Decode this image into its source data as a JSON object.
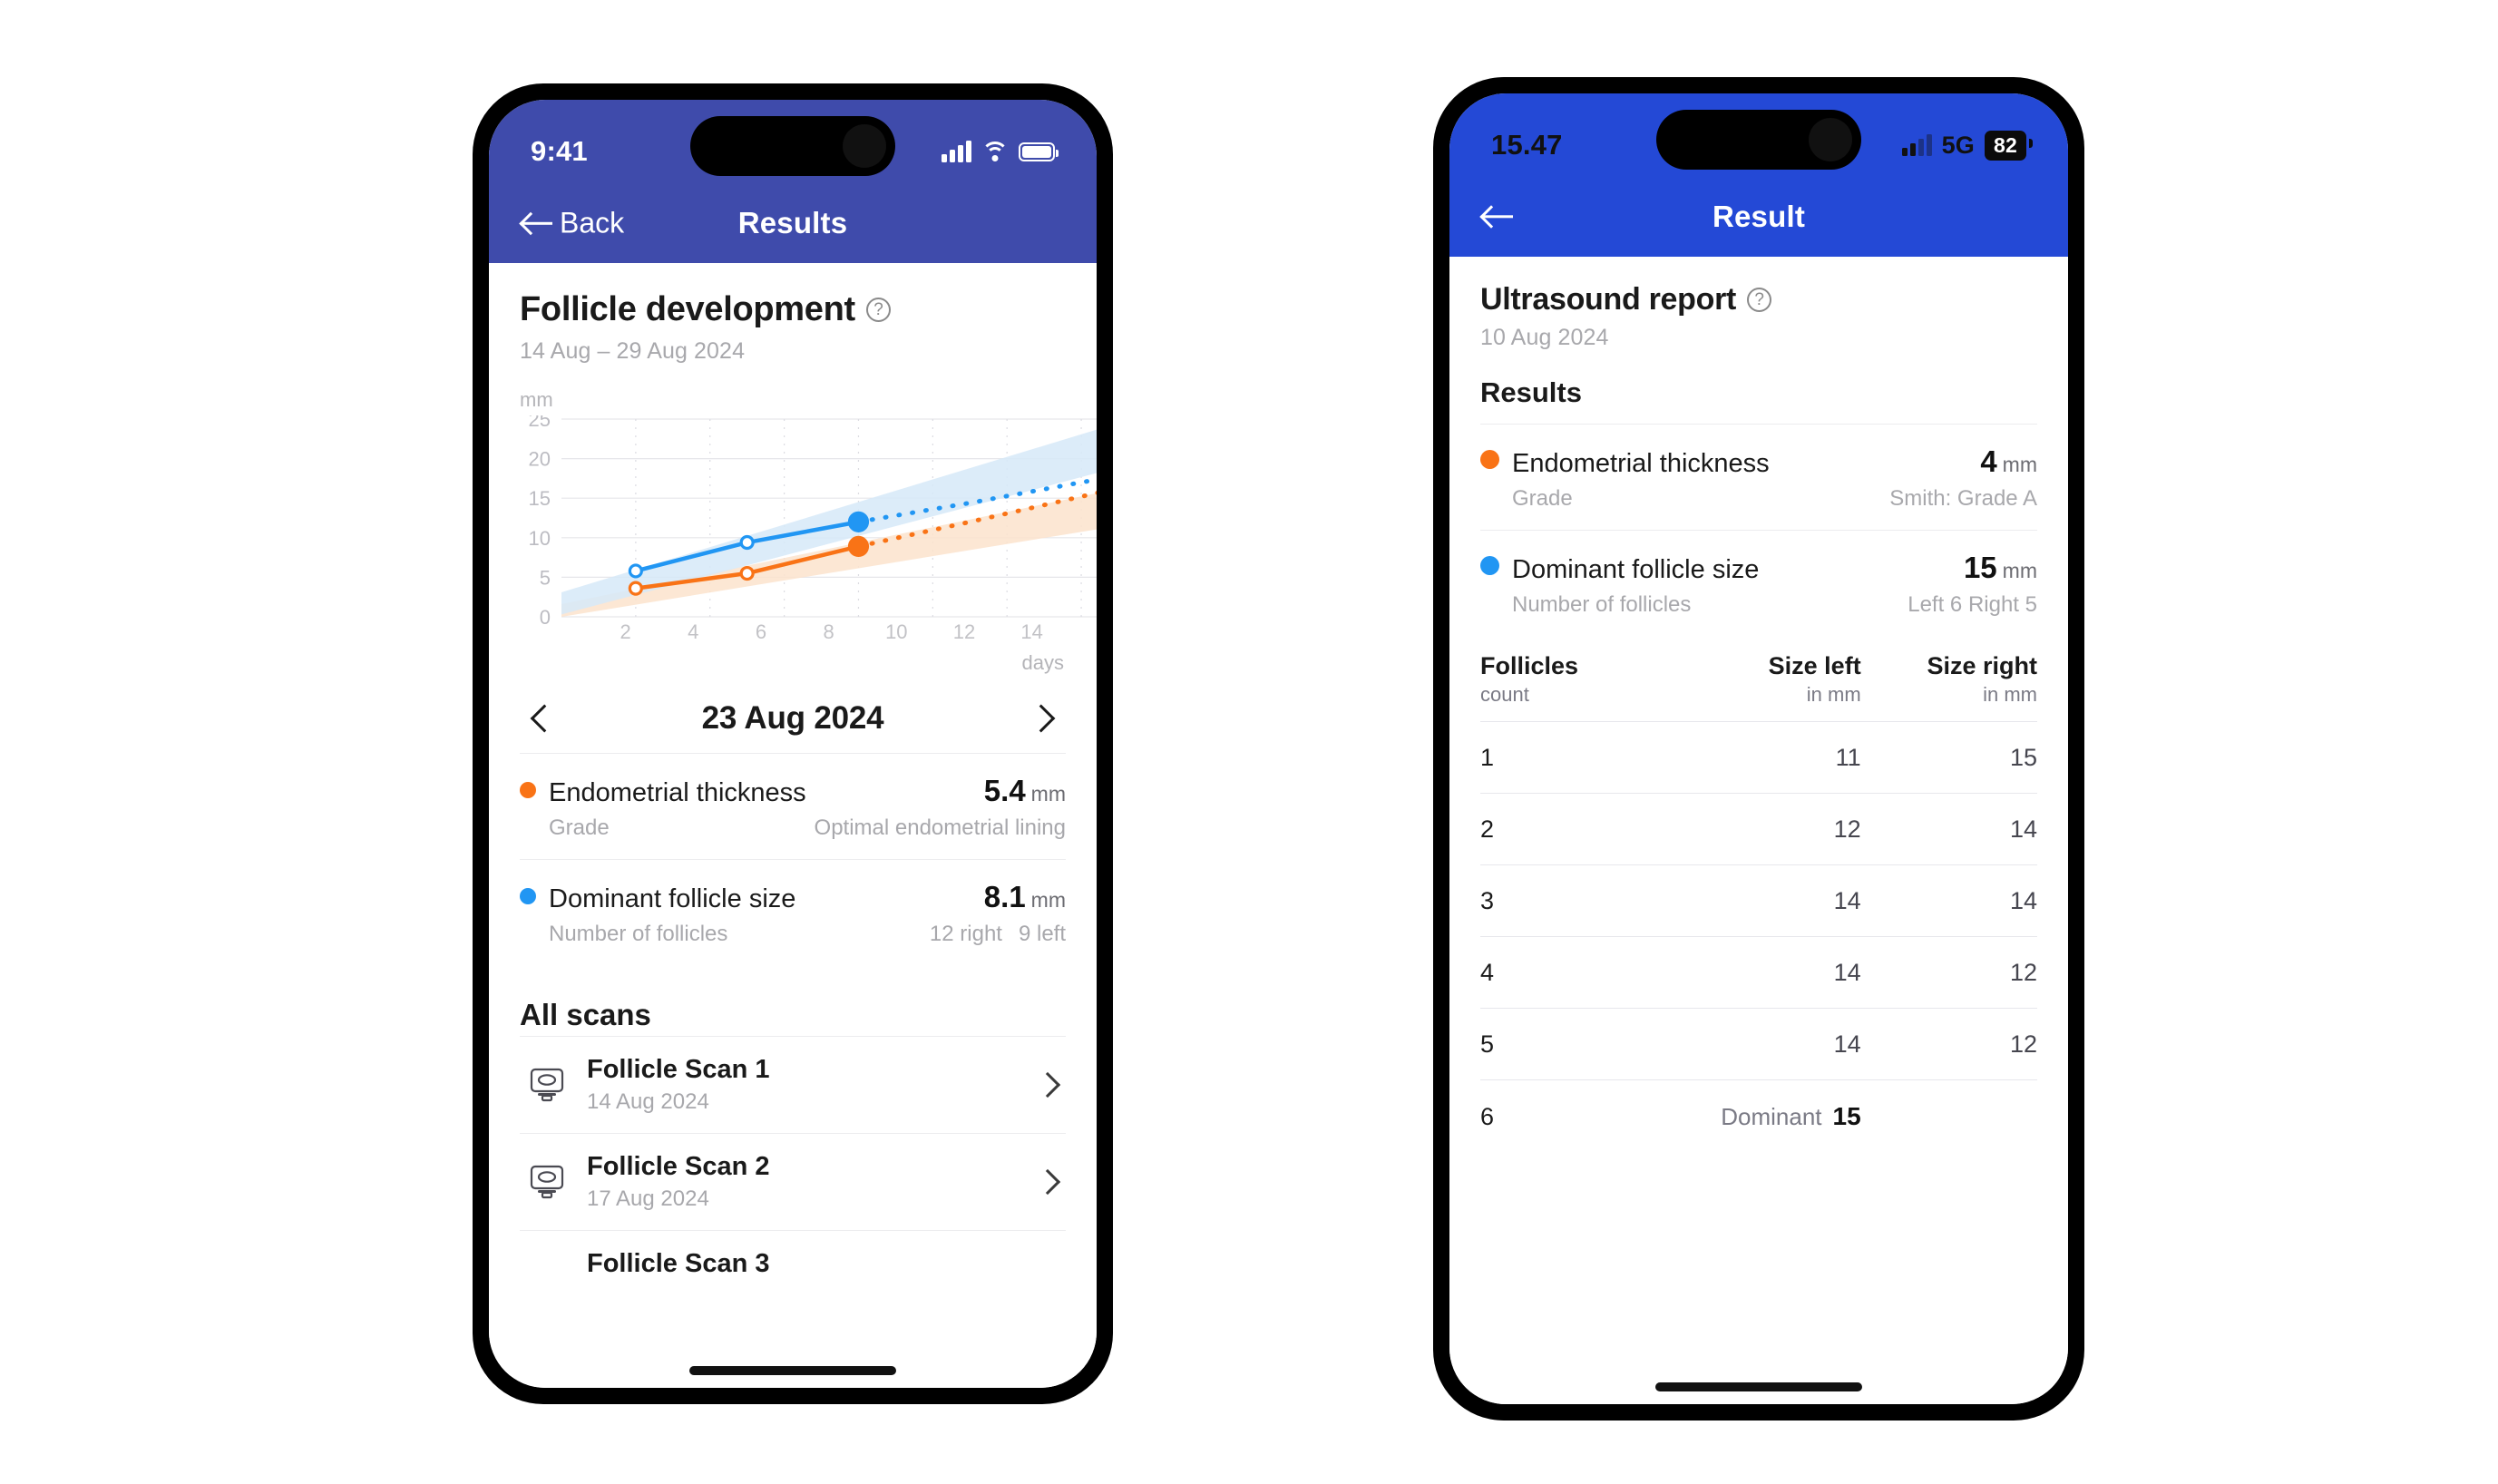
{
  "colors": {
    "header_left": "#3f4bab",
    "header_right": "#2449d6",
    "orange": "#f97316",
    "blue": "#2196f3",
    "orange_band": "#fbe3cd",
    "blue_band": "#d6e9f8",
    "text_primary": "#1a1a1a",
    "text_muted": "#a8a8ac"
  },
  "left_phone": {
    "status": {
      "time": "9:41",
      "signal_icon": "cellular-signal-icon",
      "wifi_icon": "wifi-icon",
      "battery_icon": "battery-full-icon"
    },
    "nav": {
      "back_label": "Back",
      "back_icon": "arrow-left-icon",
      "title": "Results"
    },
    "header": {
      "title": "Follicle development",
      "help_icon": "question-mark-circle-icon",
      "date_range": "14 Aug  – 29 Aug 2024"
    },
    "date_nav": {
      "prev_icon": "chevron-left-icon",
      "next_icon": "chevron-right-icon",
      "current_date": "23 Aug 2024"
    },
    "metrics": [
      {
        "dot_color": "#f97316",
        "name": "Endometrial thickness",
        "value": "5.4",
        "unit": "mm",
        "sub_label": "Grade",
        "sub_value": "Optimal endometrial lining"
      },
      {
        "dot_color": "#2196f3",
        "name": "Dominant follicle size",
        "value": "8.1",
        "unit": "mm",
        "sub_label": "Number of follicles",
        "sub_value_a": "12 right",
        "sub_value_b": "9 left"
      }
    ],
    "all_scans": {
      "title": "All scans",
      "items": [
        {
          "icon": "ultrasound-monitor-icon",
          "name": "Follicle Scan 1",
          "date": "14 Aug 2024",
          "chevron": "chevron-right-icon"
        },
        {
          "icon": "ultrasound-monitor-icon",
          "name": "Follicle Scan 2",
          "date": "17 Aug 2024",
          "chevron": "chevron-right-icon"
        },
        {
          "icon": "ultrasound-monitor-icon",
          "name": "Follicle Scan 3",
          "date": "",
          "chevron": "chevron-right-icon"
        }
      ]
    }
  },
  "right_phone": {
    "status": {
      "time": "15.47",
      "signal_icon": "cellular-signal-icon",
      "network": "5G",
      "battery_level": "82"
    },
    "nav": {
      "back_icon": "arrow-left-icon",
      "title": "Result"
    },
    "header": {
      "title": "Ultrasound report",
      "help_icon": "question-mark-circle-icon",
      "date": "10 Aug 2024"
    },
    "results_heading": "Results",
    "metrics": [
      {
        "dot_color": "#f97316",
        "name": "Endometrial thickness",
        "value": "4",
        "unit": "mm",
        "sub_label": "Grade",
        "sub_value": "Smith: Grade A"
      },
      {
        "dot_color": "#2196f3",
        "name": "Dominant follicle size",
        "value": "15",
        "unit": "mm",
        "sub_label": "Number of follicles",
        "sub_value": "Left 6 Right 5"
      }
    ],
    "table": {
      "columns": [
        {
          "main": "Follicles",
          "sub": "count"
        },
        {
          "main": "Size left",
          "sub": "in mm"
        },
        {
          "main": "Size right",
          "sub": "in mm"
        }
      ],
      "rows": [
        {
          "count": "1",
          "left": "11",
          "right": "15"
        },
        {
          "count": "2",
          "left": "12",
          "right": "14"
        },
        {
          "count": "3",
          "left": "14",
          "right": "14"
        },
        {
          "count": "4",
          "left": "14",
          "right": "12"
        },
        {
          "count": "5",
          "left": "14",
          "right": "12"
        }
      ],
      "dominant_row": {
        "count": "6",
        "label": "Dominant",
        "value": "15"
      }
    }
  },
  "chart_data": {
    "type": "line",
    "title": "Follicle development",
    "subtitle": "14 Aug  – 29 Aug 2024",
    "xlabel": "days",
    "ylabel": "mm",
    "xlim": [
      0,
      15
    ],
    "ylim": [
      0,
      25
    ],
    "xticks": [
      2,
      4,
      6,
      8,
      10,
      12,
      14
    ],
    "yticks": [
      0,
      5,
      10,
      15,
      20,
      25
    ],
    "grid": true,
    "legend": "none",
    "series": [
      {
        "name": "Dominant follicle size",
        "color": "#2196f3",
        "band_color": "#d6e9f8",
        "measured": {
          "x": [
            2,
            5,
            8
          ],
          "y": [
            5.8,
            9.4,
            12.0
          ]
        },
        "projected": {
          "x": [
            8,
            11,
            14,
            15
          ],
          "y": [
            12.0,
            14.4,
            17.0,
            17.8
          ]
        },
        "band_upper": {
          "x": [
            0,
            15
          ],
          "y": [
            3.1,
            24.5
          ]
        },
        "band_lower": {
          "x": [
            0,
            15
          ],
          "y": [
            0.3,
            18.9
          ]
        }
      },
      {
        "name": "Endometrial thickness",
        "color": "#f97316",
        "band_color": "#fbe3cd",
        "measured": {
          "x": [
            2,
            5,
            8
          ],
          "y": [
            3.6,
            5.5,
            8.9
          ]
        },
        "projected": {
          "x": [
            8,
            11,
            14,
            15
          ],
          "y": [
            8.9,
            12.0,
            15.2,
            16.3
          ]
        },
        "band_upper": {
          "x": [
            0,
            15
          ],
          "y": [
            1.6,
            16.2
          ]
        },
        "band_lower": {
          "x": [
            0,
            15
          ],
          "y": [
            0.0,
            11.5
          ]
        }
      }
    ]
  }
}
